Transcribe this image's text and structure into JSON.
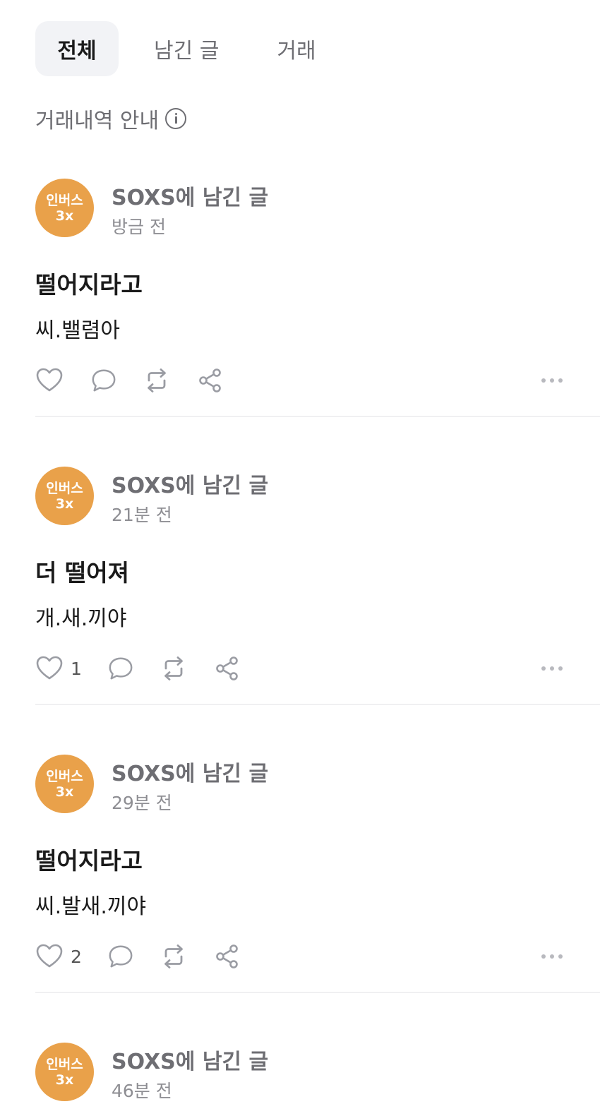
{
  "tabs": [
    {
      "label": "전체",
      "active": true
    },
    {
      "label": "남긴 글",
      "active": false
    },
    {
      "label": "거래",
      "active": false
    }
  ],
  "guide": {
    "label": "거래내역 안내",
    "icon": "info-icon"
  },
  "avatar_color": "#e9a14a",
  "posts": [
    {
      "avatar_line1": "인버스",
      "avatar_line2": "3x",
      "title": "SOXS에 남긴 글",
      "time": "방금 전",
      "heading": "떨어지라고",
      "body": "씨.밸렴아",
      "likes": ""
    },
    {
      "avatar_line1": "인버스",
      "avatar_line2": "3x",
      "title": "SOXS에 남긴 글",
      "time": "21분 전",
      "heading": "더 떨어져",
      "body": "개.새.끼야",
      "likes": "1"
    },
    {
      "avatar_line1": "인버스",
      "avatar_line2": "3x",
      "title": "SOXS에 남긴 글",
      "time": "29분 전",
      "heading": "떨어지라고",
      "body": "씨.발새.끼야",
      "likes": "2"
    },
    {
      "avatar_line1": "인버스",
      "avatar_line2": "3x",
      "title": "SOXS에 남긴 글",
      "time": "46분 전",
      "heading": "",
      "body": "",
      "likes": ""
    }
  ]
}
